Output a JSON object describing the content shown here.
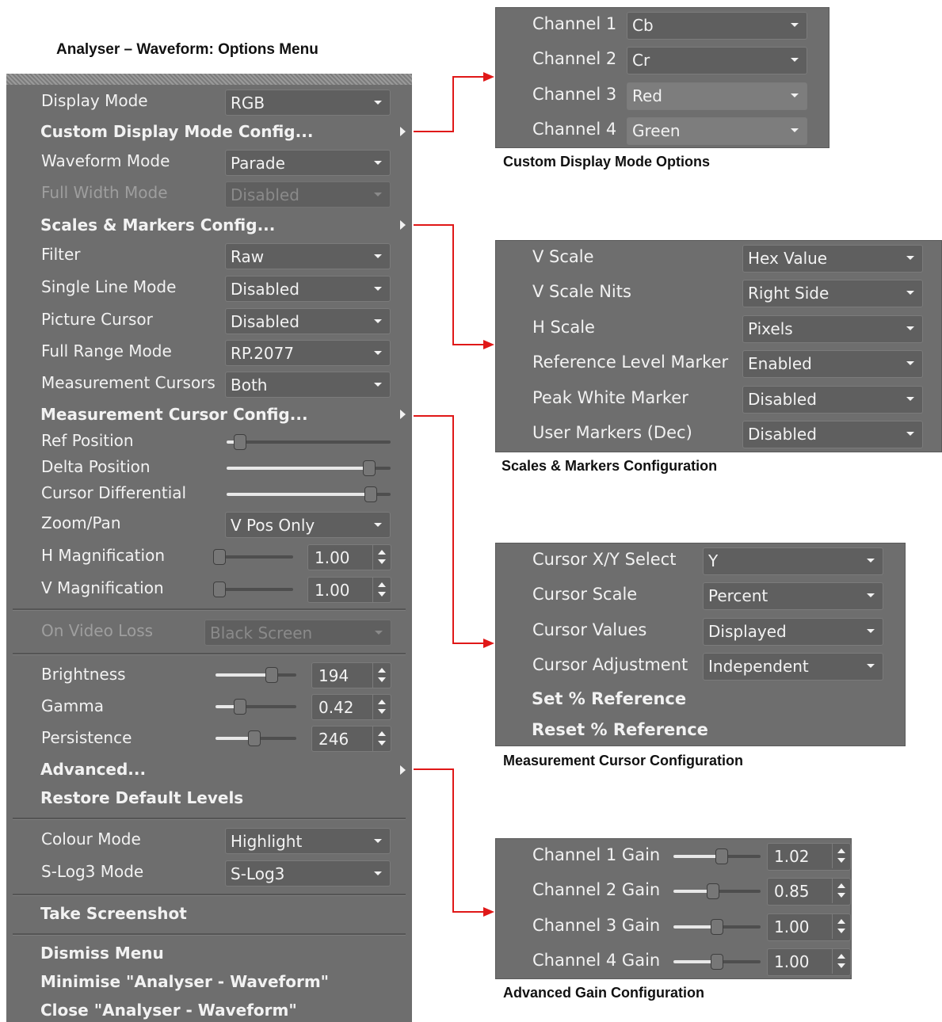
{
  "title": "Analyser – Waveform: Options Menu",
  "menu": {
    "display_mode": {
      "label": "Display Mode",
      "value": "RGB"
    },
    "custom_display_mode_config": "Custom Display Mode Config...",
    "waveform_mode": {
      "label": "Waveform Mode",
      "value": "Parade"
    },
    "full_width_mode": {
      "label": "Full Width Mode",
      "value": "Disabled"
    },
    "scales_markers_config": "Scales & Markers Config...",
    "filter": {
      "label": "Filter",
      "value": "Raw"
    },
    "single_line_mode": {
      "label": "Single Line Mode",
      "value": "Disabled"
    },
    "picture_cursor": {
      "label": "Picture Cursor",
      "value": "Disabled"
    },
    "full_range_mode": {
      "label": "Full Range Mode",
      "value": "RP.2077"
    },
    "measurement_cursors": {
      "label": "Measurement Cursors",
      "value": "Both"
    },
    "measurement_cursor_config": "Measurement Cursor Config...",
    "ref_position": {
      "label": "Ref Position",
      "level": 0.08
    },
    "delta_position": {
      "label": "Delta Position",
      "level": 0.87
    },
    "cursor_differential": {
      "label": "Cursor Differential",
      "level": 0.88
    },
    "zoom_pan": {
      "label": "Zoom/Pan",
      "value": "V Pos Only"
    },
    "h_magnification": {
      "label": "H Magnification",
      "value": "1.00",
      "level": 0.05
    },
    "v_magnification": {
      "label": "V Magnification",
      "value": "1.00",
      "level": 0.05
    },
    "on_video_loss": {
      "label": "On Video Loss",
      "value": "Black Screen"
    },
    "brightness": {
      "label": "Brightness",
      "value": "194",
      "level": 0.7
    },
    "gamma": {
      "label": "Gamma",
      "value": "0.42",
      "level": 0.3
    },
    "persistence": {
      "label": "Persistence",
      "value": "246",
      "level": 0.48
    },
    "advanced": "Advanced...",
    "restore_default_levels": "Restore Default Levels",
    "colour_mode": {
      "label": "Colour Mode",
      "value": "Highlight"
    },
    "slog3_mode": {
      "label": "S-Log3 Mode",
      "value": "S-Log3"
    },
    "take_screenshot": "Take Screenshot",
    "dismiss_menu": "Dismiss Menu",
    "minimise": "Minimise \"Analyser - Waveform\"",
    "close": "Close \"Analyser - Waveform\""
  },
  "custom_display_panel": {
    "caption": "Custom Display Mode Options",
    "rows": [
      {
        "label": "Channel 1",
        "value": "Cb"
      },
      {
        "label": "Channel 2",
        "value": "Cr"
      },
      {
        "label": "Channel 3",
        "value": "Red"
      },
      {
        "label": "Channel 4",
        "value": "Green"
      }
    ]
  },
  "scales_panel": {
    "caption": "Scales & Markers Configuration",
    "rows": [
      {
        "label": "V Scale",
        "value": "Hex Value"
      },
      {
        "label": "V Scale Nits",
        "value": "Right Side"
      },
      {
        "label": "H Scale",
        "value": "Pixels"
      },
      {
        "label": "Reference Level Marker",
        "value": "Enabled"
      },
      {
        "label": "Peak White Marker",
        "value": "Disabled"
      },
      {
        "label": "User Markers (Dec)",
        "value": "Disabled"
      }
    ]
  },
  "cursor_panel": {
    "caption": "Measurement Cursor Configuration",
    "rows": [
      {
        "label": "Cursor X/Y Select",
        "value": "Y"
      },
      {
        "label": "Cursor Scale",
        "value": "Percent"
      },
      {
        "label": "Cursor Values",
        "value": "Displayed"
      },
      {
        "label": "Cursor Adjustment",
        "value": "Independent"
      }
    ],
    "set_reference": "Set % Reference",
    "reset_reference": "Reset % Reference"
  },
  "gain_panel": {
    "caption": "Advanced Gain Configuration",
    "rows": [
      {
        "label": "Channel 1 Gain",
        "value": "1.02",
        "level": 0.55
      },
      {
        "label": "Channel 2 Gain",
        "value": "0.85",
        "level": 0.45
      },
      {
        "label": "Channel 3 Gain",
        "value": "1.00",
        "level": 0.5
      },
      {
        "label": "Channel 4 Gain",
        "value": "1.00",
        "level": 0.5
      }
    ]
  },
  "colors": {
    "menu_bg": "#6e6e6e",
    "connector": "#e01818",
    "text": "#f2f2f2"
  }
}
